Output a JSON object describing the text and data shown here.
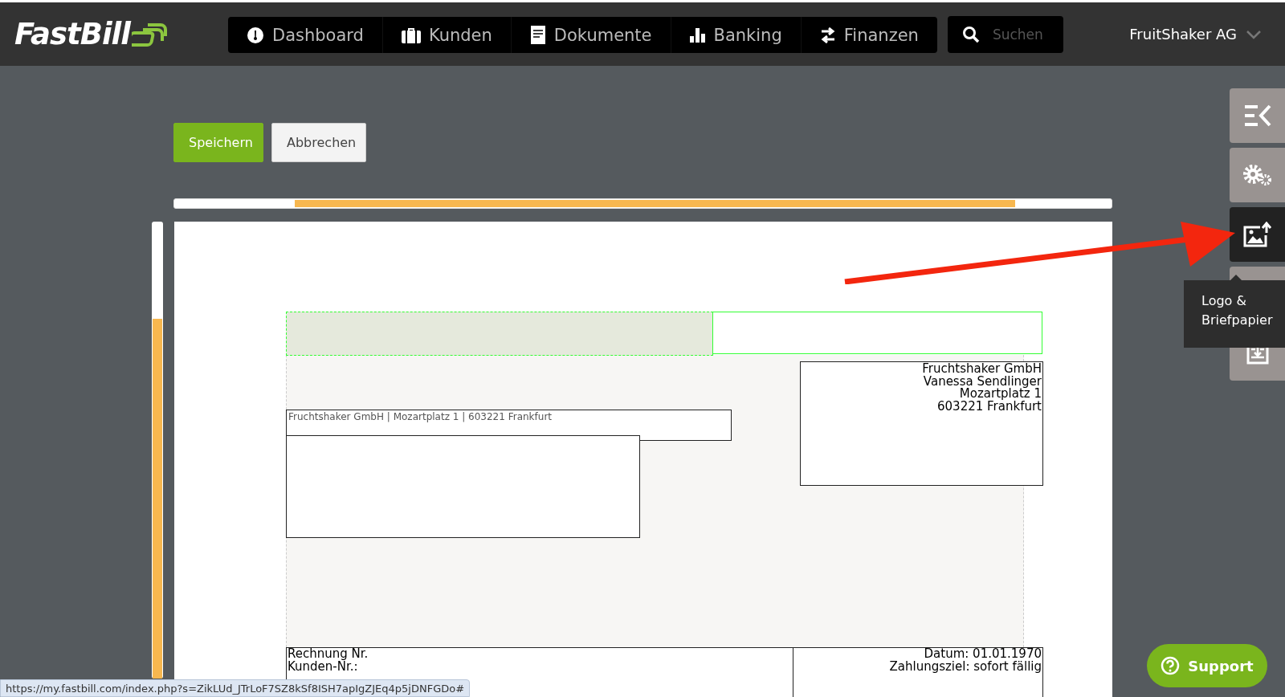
{
  "header": {
    "logo": "FastBill",
    "nav": [
      {
        "label": "Dashboard"
      },
      {
        "label": "Kunden"
      },
      {
        "label": "Dokumente"
      },
      {
        "label": "Banking"
      },
      {
        "label": "Finanzen"
      }
    ],
    "search": {
      "placeholder": "Suchen"
    },
    "account": "FruitShaker AG"
  },
  "actions": [
    {
      "label": "Speichern",
      "kind": "primary"
    },
    {
      "label": "Abbrechen",
      "kind": "secondary"
    }
  ],
  "letter": {
    "sender_line": "Fruchtshaker GmbH | Mozartplatz 1 | 603221 Frankfurt",
    "address": [
      "Fruchtshaker GmbH",
      "Vanessa Sendlinger",
      "Mozartplatz 1",
      "603221 Frankfurt"
    ],
    "info_left": [
      "Rechnung Nr.",
      "Kunden-Nr.:"
    ],
    "info_right": [
      "Datum: 01.01.1970",
      "Zahlungsziel: sofort fällig"
    ]
  },
  "tools": [
    {
      "selected": false
    },
    {
      "selected": false
    },
    {
      "selected": true
    },
    {
      "selected": false
    },
    {
      "selected": false
    }
  ],
  "tooltip": "Logo & Briefpapier",
  "support": "Support",
  "status_url": "https://my.fastbill.com/index.php?s=ZikLUd_JTrLoF7SZ8kSf8ISH7apIgZJEq4p5jDNFGDo#"
}
